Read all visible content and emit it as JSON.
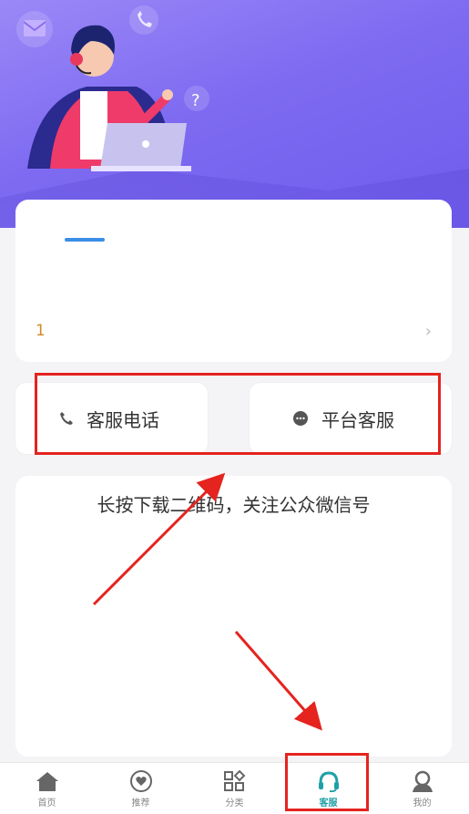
{
  "banner": {
    "illustration": "customer-service-agent"
  },
  "info_card": {
    "number": "1",
    "chevron": "›"
  },
  "buttons": {
    "phone_label": "客服电话",
    "chat_label": "平台客服"
  },
  "qr_card": {
    "text": "长按下载二维码，关注公众微信号"
  },
  "tabbar": {
    "items": [
      {
        "label": "首页",
        "icon": "home-icon"
      },
      {
        "label": "推荐",
        "icon": "heart-icon"
      },
      {
        "label": "分类",
        "icon": "category-icon"
      },
      {
        "label": "客服",
        "icon": "headset-icon",
        "active": true
      },
      {
        "label": "我的",
        "icon": "user-icon"
      }
    ]
  },
  "colors": {
    "accent": "#1fa0a8",
    "annotation": "#e5231f",
    "banner": "#7e6bf1",
    "number": "#d28a2a"
  }
}
